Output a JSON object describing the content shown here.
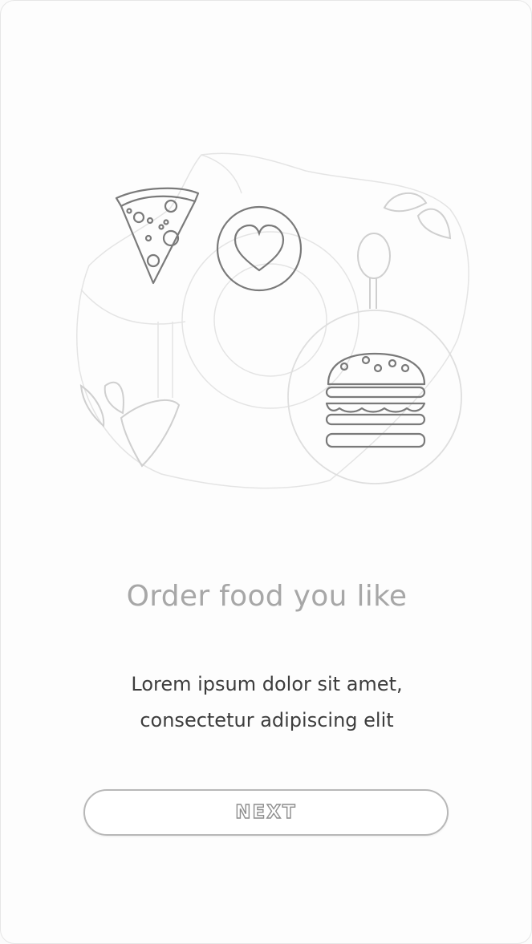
{
  "onboarding": {
    "title": "Order food you like",
    "description_line1": "Lorem ipsum dolor sit amet,",
    "description_line2": "consectetur adipiscing elit",
    "next_label": "NEXT"
  },
  "icons": [
    "pizza-icon",
    "heart-icon",
    "spoon-icon",
    "burger-icon",
    "leaf-icon"
  ],
  "colors": {
    "background": "#fdfdfd",
    "title": "#a7a7a7",
    "body_text": "#3d3d3d",
    "outline": "#c8c8c8",
    "button_border": "#b8b8b8"
  }
}
